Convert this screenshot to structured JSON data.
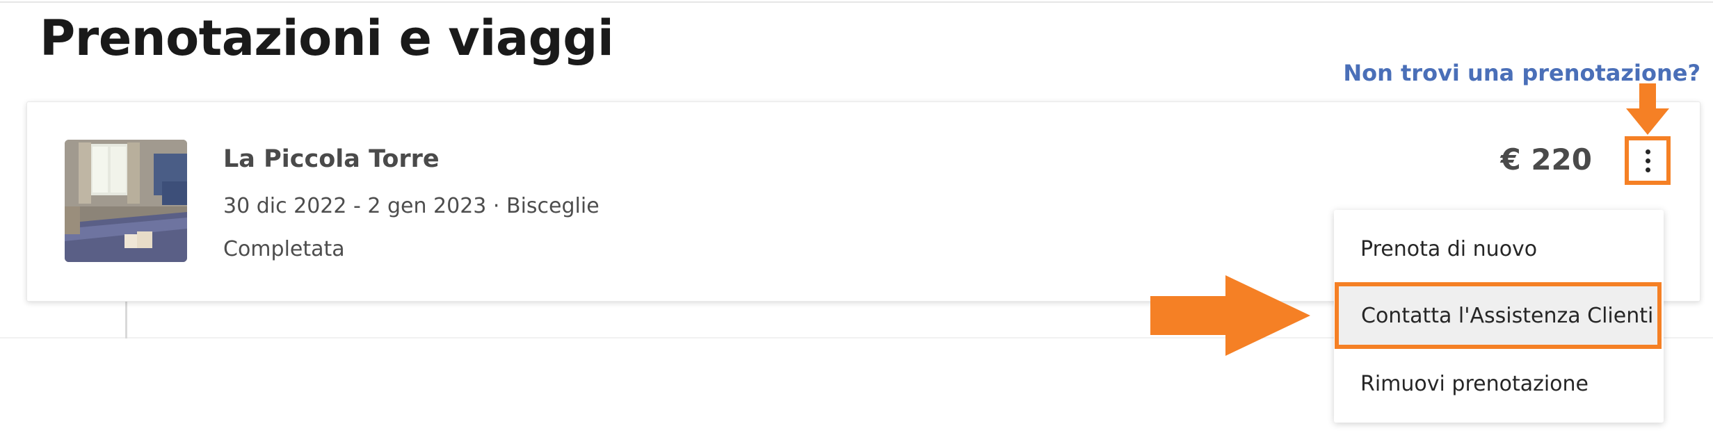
{
  "page": {
    "title": "Prenotazioni e viaggi",
    "help_link": "Non trovi una prenotazione?"
  },
  "booking": {
    "hotel_name": "La Piccola Torre",
    "dates_location": "30 dic 2022 - 2 gen 2023 · Bisceglie",
    "status": "Completata",
    "price": "€ 220"
  },
  "menu": {
    "items": [
      {
        "label": "Prenota di nuovo"
      },
      {
        "label": "Contatta l'Assistenza Clienti"
      },
      {
        "label": "Rimuovi prenotazione"
      }
    ]
  },
  "icons": {
    "more_options": "kebab-vertical-icon",
    "annotation_arrow_down": "arrow-down-icon",
    "annotation_arrow_right": "arrow-right-icon"
  },
  "colors": {
    "highlight": "#f58025",
    "link": "#4a6fb8",
    "text": "#262626"
  }
}
